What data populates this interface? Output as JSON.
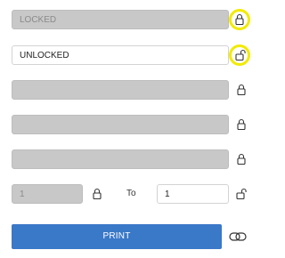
{
  "rows": [
    {
      "label": "LOCKED",
      "state": "locked",
      "icon": "lock-closed-icon",
      "highlighted": true
    },
    {
      "label": "UNLOCKED",
      "state": "unlocked",
      "icon": "lock-open-icon",
      "highlighted": true
    },
    {
      "label": "",
      "state": "locked",
      "icon": "lock-closed-icon",
      "highlighted": false
    },
    {
      "label": "",
      "state": "locked",
      "icon": "lock-closed-icon",
      "highlighted": false
    },
    {
      "label": "",
      "state": "locked",
      "icon": "lock-closed-icon",
      "highlighted": false
    }
  ],
  "range": {
    "from_value": "1",
    "from_state": "locked",
    "to_label": "To",
    "to_value": "1",
    "to_state": "unlocked"
  },
  "print_button": {
    "label": "PRINT",
    "color": "#3a78c8"
  },
  "icons": {
    "link_toggle": "link-icon"
  },
  "highlight_color": "#f2ea00"
}
